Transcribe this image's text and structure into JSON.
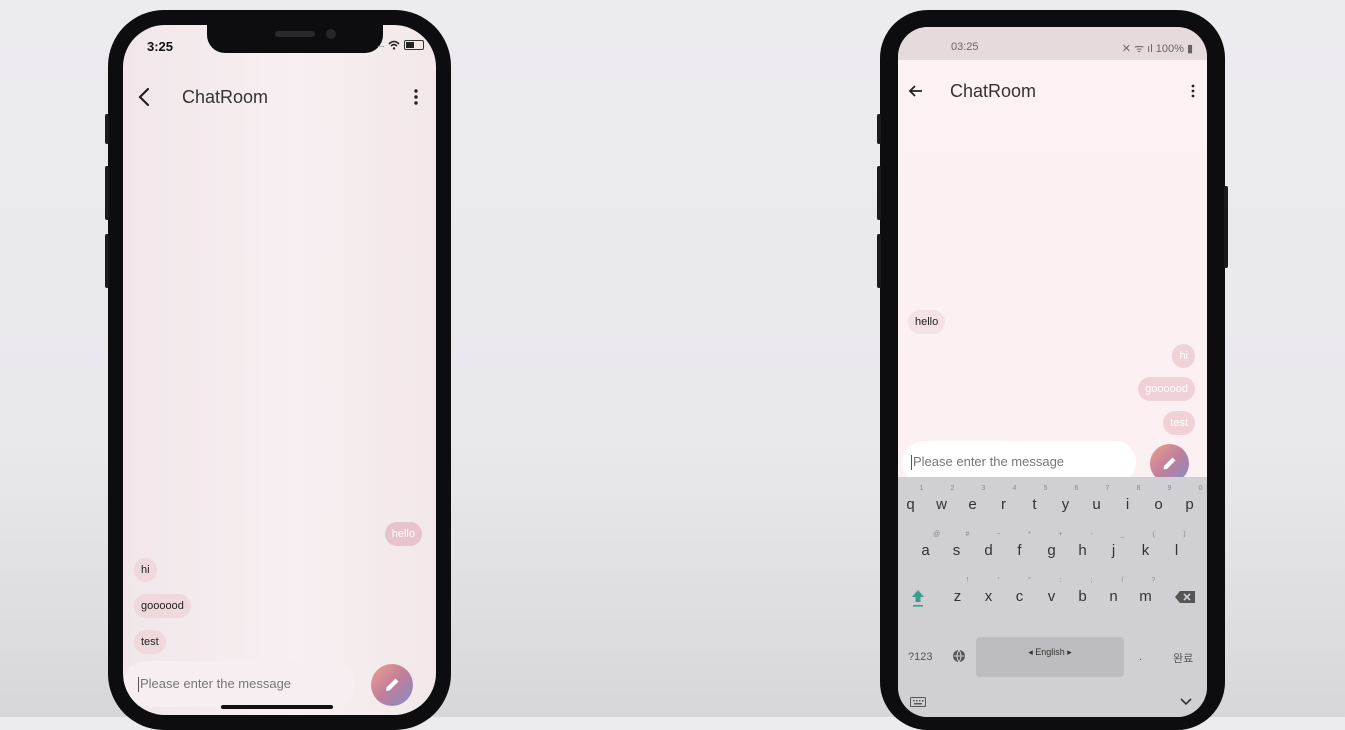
{
  "iphone": {
    "status_time": "3:25",
    "status_signal": "....",
    "title": "ChatRoom",
    "messages": [
      {
        "text": "hello",
        "side": "sent"
      },
      {
        "text": "hi",
        "side": "received"
      },
      {
        "text": "goooood",
        "side": "received"
      },
      {
        "text": "test",
        "side": "received"
      }
    ],
    "input_placeholder": "Please enter the message"
  },
  "android": {
    "status_time": "03:25",
    "status_right": "100%",
    "title": "ChatRoom",
    "messages": [
      {
        "text": "hello",
        "side": "received"
      },
      {
        "text": "hi",
        "side": "sent"
      },
      {
        "text": "goooood",
        "side": "sent"
      },
      {
        "text": "test",
        "side": "sent"
      }
    ],
    "input_placeholder": "Please enter the message",
    "keyboard": {
      "row1": [
        "q",
        "w",
        "e",
        "r",
        "t",
        "y",
        "u",
        "i",
        "o",
        "p"
      ],
      "row1_hints": [
        "1",
        "2",
        "3",
        "4",
        "5",
        "6",
        "7",
        "8",
        "9",
        "0"
      ],
      "row2": [
        "a",
        "s",
        "d",
        "f",
        "g",
        "h",
        "j",
        "k",
        "l"
      ],
      "row2_hints": [
        "@",
        "#",
        "~",
        "*",
        "+",
        "-",
        "_",
        "(",
        ")"
      ],
      "row3": [
        "z",
        "x",
        "c",
        "v",
        "b",
        "n",
        "m"
      ],
      "row3_hints": [
        "!",
        "'",
        "\"",
        ":",
        ";",
        "/",
        "?"
      ],
      "symbols_key": "?123",
      "space_label": "English",
      "period_key": ".",
      "done_key": "완료"
    }
  },
  "colors": {
    "sent_bubble": "#e7c3cb",
    "received_bubble": "#efd9dd",
    "fab_gradient": [
      "#ef9f8f",
      "#c07f99",
      "#7f8dc7"
    ]
  },
  "icons": {
    "back_ios": "chevron-left-icon",
    "back_android": "arrow-left-icon",
    "menu": "more-vertical-icon",
    "send": "pencil-icon",
    "shift": "arrow-up-icon",
    "backspace": "backspace-icon",
    "globe": "globe-icon",
    "keyboard": "keyboard-icon",
    "hide": "chevron-down-icon"
  }
}
